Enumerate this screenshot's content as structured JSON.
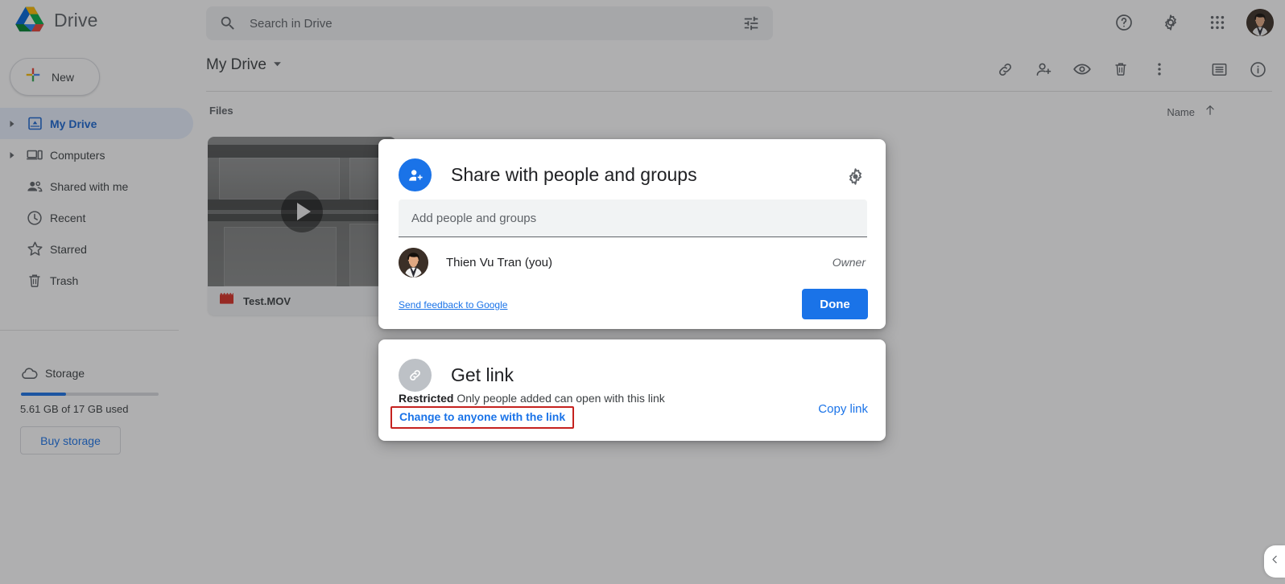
{
  "header": {
    "brand_name": "Drive",
    "logo_icon": "google-drive-logo",
    "search": {
      "placeholder": "Search in Drive",
      "value": "",
      "search_icon": "search-icon",
      "tune_icon": "tune-filter-icon"
    },
    "actions": [
      {
        "name": "help-button",
        "icon": "help-circle-icon"
      },
      {
        "name": "settings-button",
        "icon": "gear-icon"
      },
      {
        "name": "google-apps-button",
        "icon": "apps-grid-icon"
      }
    ],
    "avatar": {
      "name": "account-avatar",
      "icon": "user-photo-avatar"
    }
  },
  "sidebar": {
    "new_button": {
      "label": "New",
      "icon": "plus-icon"
    },
    "items": [
      {
        "label": "My Drive",
        "icon": "drive-my-drive-icon",
        "active": true,
        "caret": true
      },
      {
        "label": "Computers",
        "icon": "computers-icon",
        "active": false,
        "caret": true
      },
      {
        "label": "Shared with me",
        "icon": "people-shared-icon",
        "active": false,
        "caret": false
      },
      {
        "label": "Recent",
        "icon": "clock-recent-icon",
        "active": false,
        "caret": false
      },
      {
        "label": "Starred",
        "icon": "star-icon",
        "active": false,
        "caret": false
      },
      {
        "label": "Trash",
        "icon": "trash-icon",
        "active": false,
        "caret": false
      }
    ],
    "storage": {
      "label": "Storage",
      "icon": "cloud-icon",
      "used_text": "5.61 GB of 17 GB used",
      "percent_used": 33,
      "buy_label": "Buy storage",
      "bar_color": "#1a73e8"
    }
  },
  "content": {
    "breadcrumb": {
      "label": "My Drive",
      "caret_icon": "chevron-down-icon"
    },
    "toolbar": [
      {
        "name": "get-link-button",
        "icon": "link-icon"
      },
      {
        "name": "add-people-button",
        "icon": "person-add-icon"
      },
      {
        "name": "preview-button",
        "icon": "eye-preview-icon"
      },
      {
        "name": "remove-button",
        "icon": "trash-icon"
      },
      {
        "name": "more-actions-button",
        "icon": "more-vertical-icon"
      },
      {
        "name": "list-view-button",
        "icon": "list-view-icon"
      },
      {
        "name": "details-button",
        "icon": "info-circle-icon"
      }
    ],
    "section_label": "Files",
    "sort": {
      "label": "Name",
      "direction_icon": "arrow-up-icon"
    },
    "files": [
      {
        "name": "Test.MOV",
        "type_icon": "video-file-icon",
        "thumb": "video-thumbnail",
        "play_icon": "play-icon"
      }
    ],
    "corner_tab_icon": "chevron-left-icon"
  },
  "share_dialog": {
    "title": "Share with people and groups",
    "title_icon": "person-add-icon",
    "settings_icon": "gear-icon",
    "add_field": {
      "placeholder": "Add people and groups",
      "value": ""
    },
    "people": [
      {
        "name": "Thien Vu Tran (you)",
        "role": "Owner",
        "avatar_icon": "user-photo-avatar"
      }
    ],
    "feedback_label": "Send feedback to Google",
    "done_label": "Done",
    "done_color": "#1a73e8"
  },
  "get_link_dialog": {
    "title": "Get link",
    "title_icon": "link-icon",
    "access_level": "Restricted",
    "access_description": "Only people added can open with this link",
    "change_link_label": "Change to anyone with the link",
    "copy_link_label": "Copy link",
    "highlight_color": "#c5221f"
  }
}
